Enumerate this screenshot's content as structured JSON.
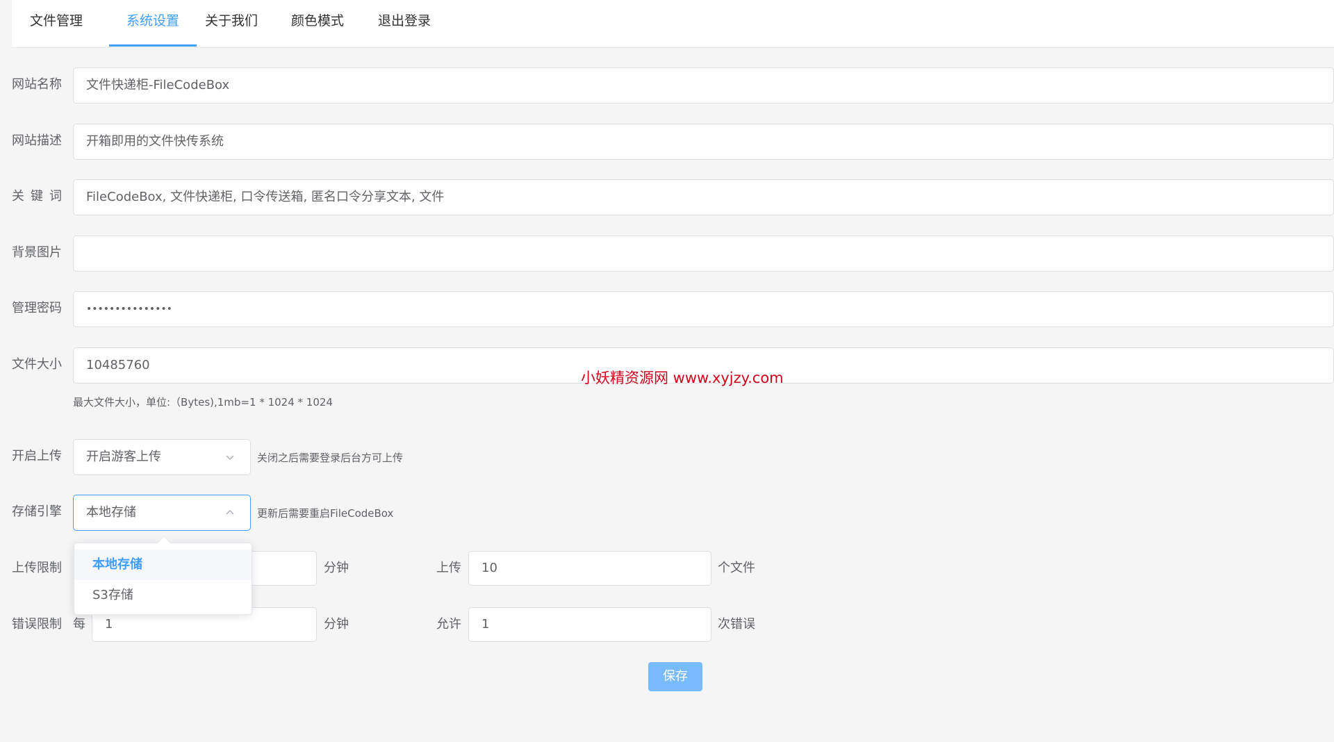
{
  "tabs": [
    {
      "label": "文件管理"
    },
    {
      "label": "系统设置"
    },
    {
      "label": "关于我们"
    },
    {
      "label": "颜色模式"
    },
    {
      "label": "退出登录"
    }
  ],
  "active_tab": "系统设置",
  "form": {
    "site_name": {
      "label": "网站名称",
      "value": "文件快递柜-FileCodeBox"
    },
    "site_desc": {
      "label": "网站描述",
      "value": "开箱即用的文件快传系统"
    },
    "keywords": {
      "label": "关键词",
      "value": "FileCodeBox, 文件快递柜, 口令传送箱, 匿名口令分享文本, 文件"
    },
    "bg_image": {
      "label": "背景图片",
      "value": ""
    },
    "admin_password": {
      "label": "管理密码",
      "value": "•••••••••••••••"
    },
    "file_size": {
      "label": "文件大小",
      "value": "10485760",
      "hint": "最大文件大小，单位:（Bytes),1mb=1 * 1024 * 1024"
    },
    "upload": {
      "label": "开启上传",
      "value": "开启游客上传",
      "hint": "关闭之后需要登录后台方可上传"
    },
    "storage": {
      "label": "存储引擎",
      "value": "本地存储",
      "hint": "更新后需要重启FileCodeBox",
      "options": [
        "本地存储",
        "S3存储"
      ]
    },
    "upload_limit": {
      "label": "上传限制",
      "unit1": "分钟",
      "mid": "上传",
      "count": "10",
      "unit2": "个文件"
    },
    "error_limit": {
      "label": "错误限制",
      "prefix": "每",
      "minutes": "1",
      "unit1": "分钟",
      "mid": "允许",
      "count": "1",
      "unit2": "次错误"
    }
  },
  "save_label": "保存",
  "watermark": "小妖精资源网 www.xyjzy.com",
  "colors": {
    "accent": "#409eff",
    "button": "#79bbff",
    "watermark": "#d0021b"
  }
}
